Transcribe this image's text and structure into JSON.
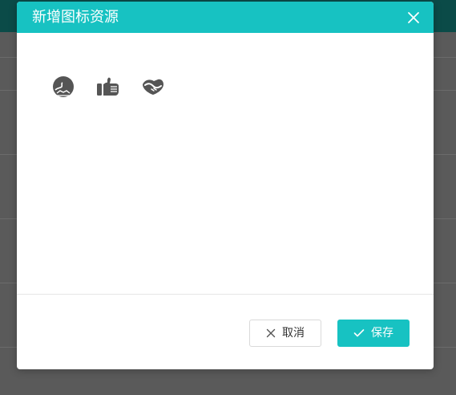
{
  "dialog": {
    "title": "新增图标资源",
    "close_icon": "close-icon"
  },
  "icons": [
    {
      "name": "globe-icon"
    },
    {
      "name": "thumbs-up-icon"
    },
    {
      "name": "handshake-icon"
    }
  ],
  "footer": {
    "cancel_label": "取消",
    "save_label": "保存"
  },
  "colors": {
    "accent": "#17c2c2",
    "backdrop": "#5a5a5a",
    "icon_gray": "#555555"
  }
}
